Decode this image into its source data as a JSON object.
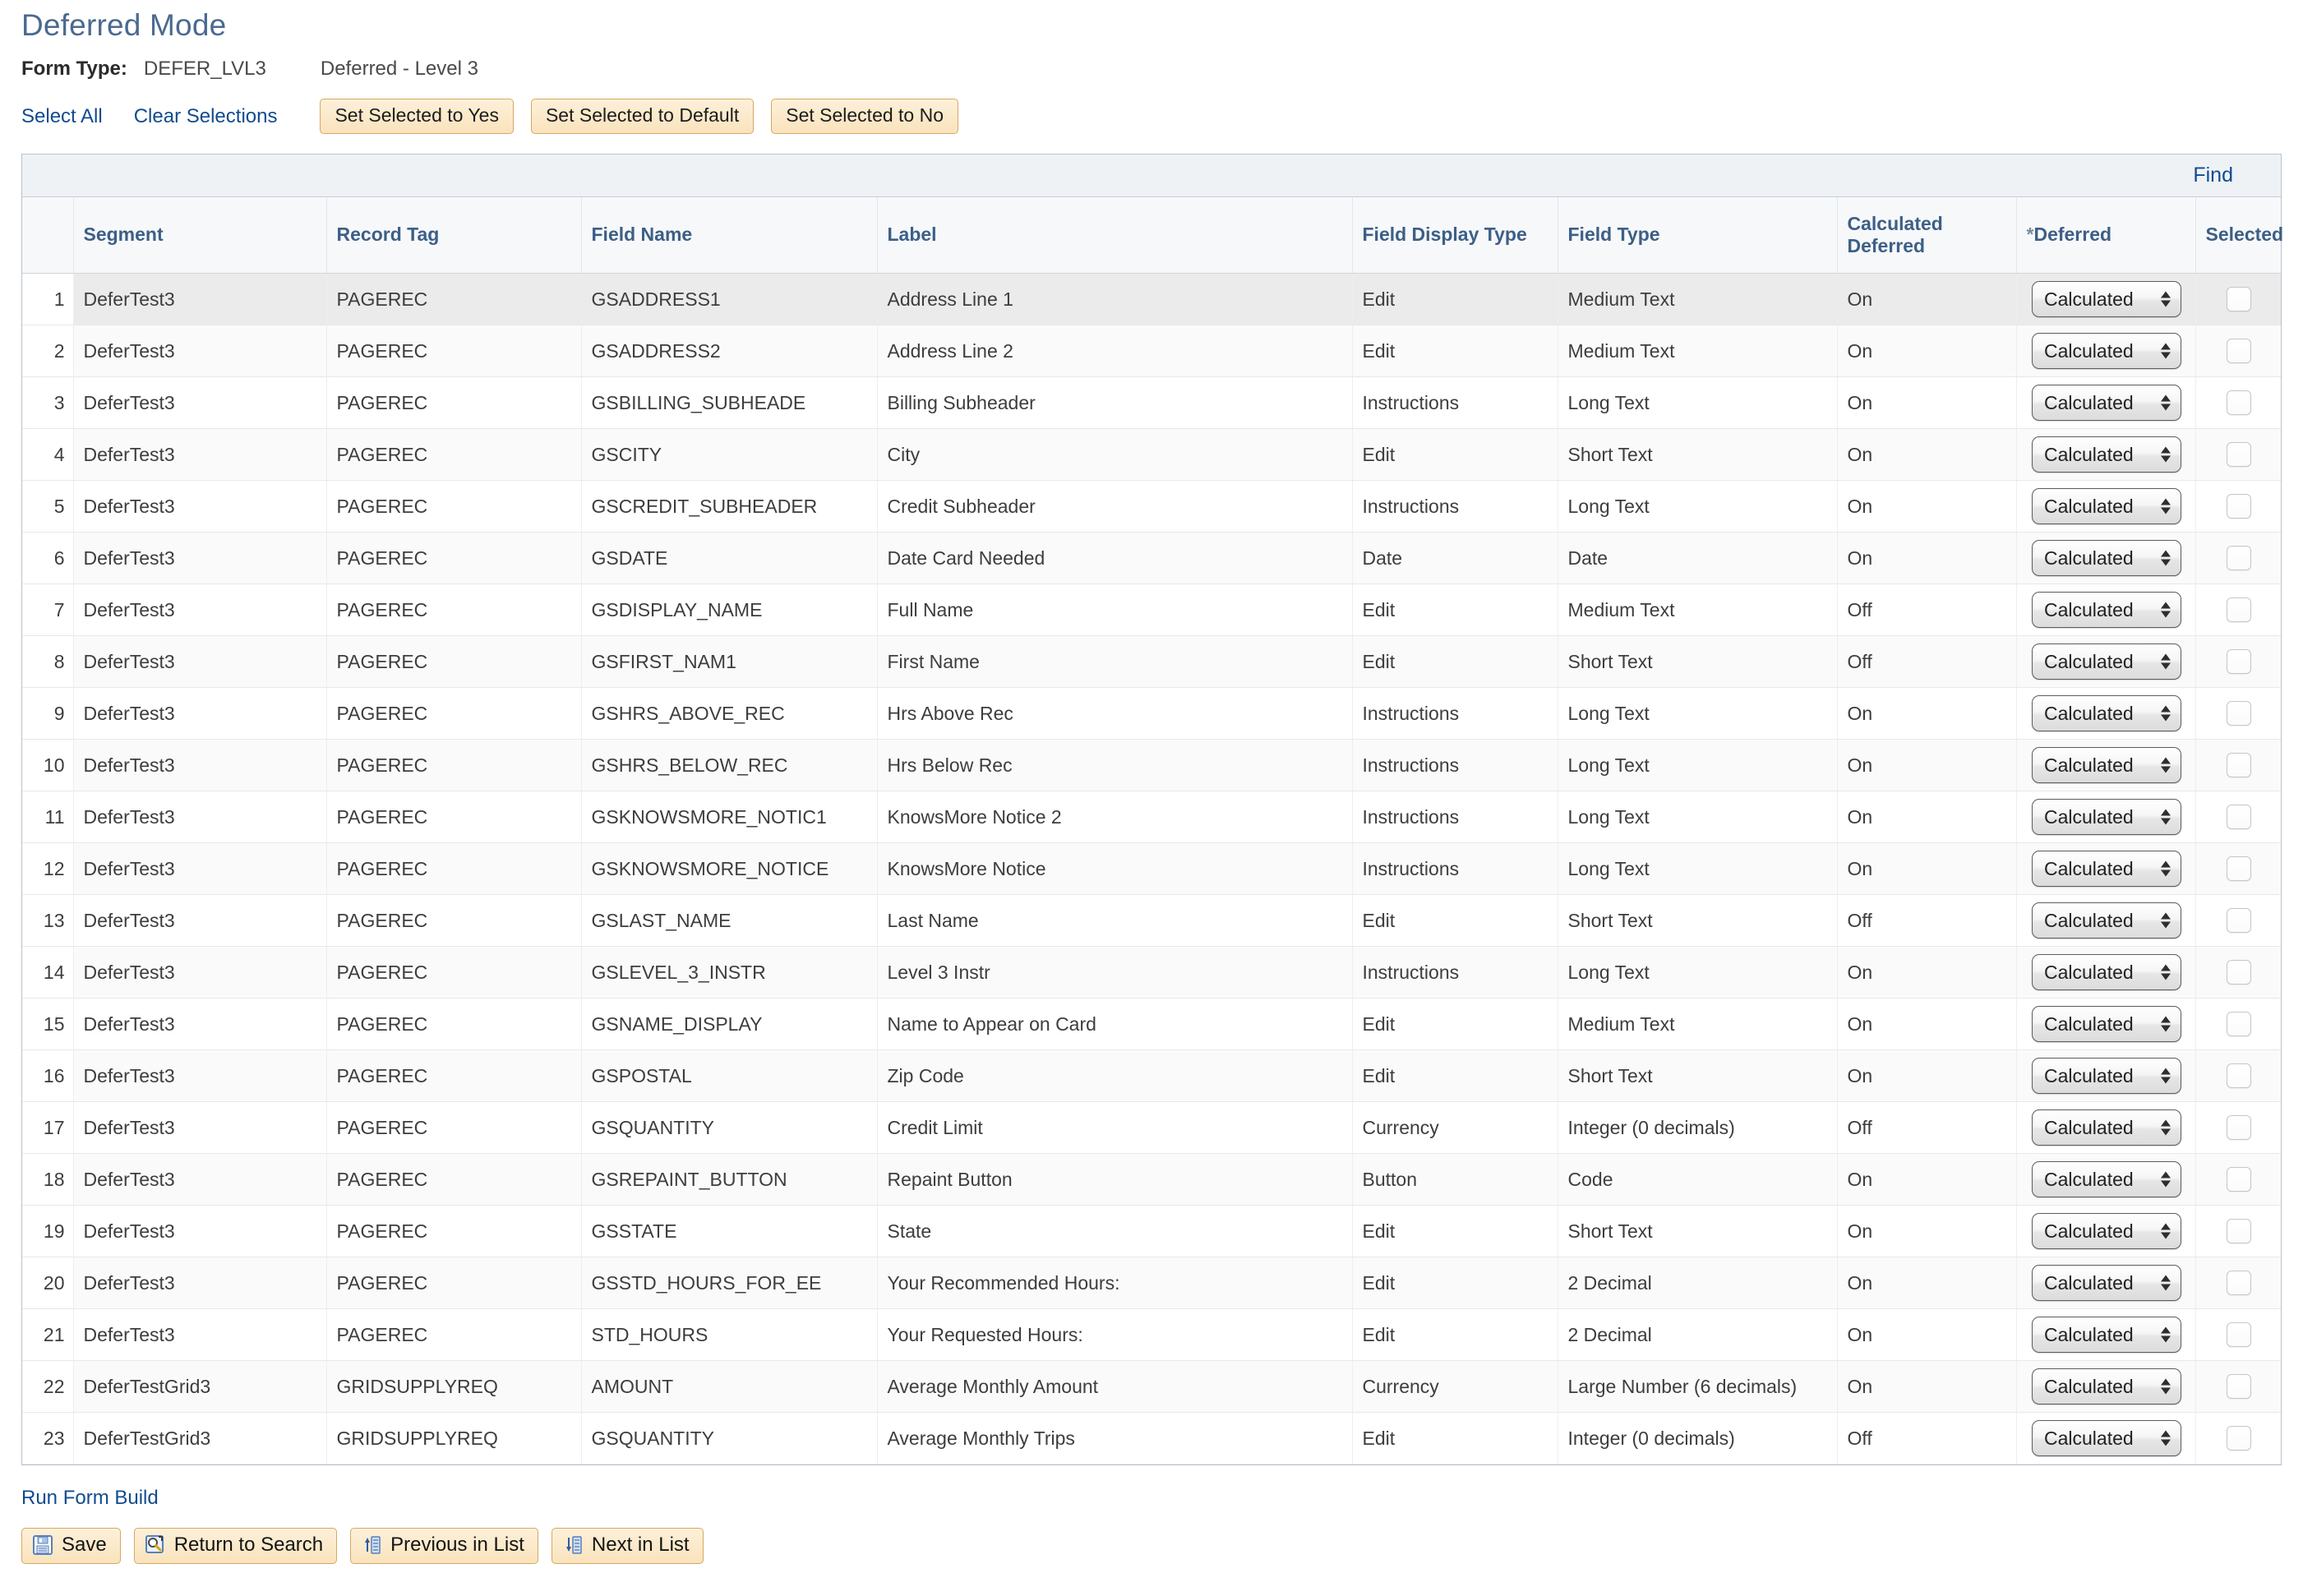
{
  "page": {
    "title": "Deferred Mode"
  },
  "form_type": {
    "label": "Form Type:",
    "value": "DEFER_LVL3",
    "description": "Deferred - Level 3"
  },
  "actions": {
    "select_all": "Select All",
    "clear_selections": "Clear Selections",
    "set_yes": "Set Selected to Yes",
    "set_default": "Set Selected to Default",
    "set_no": "Set Selected to No"
  },
  "grid": {
    "find_link": "Find",
    "columns": [
      "",
      "Segment",
      "Record Tag",
      "Field Name",
      "Label",
      "Field Display Type",
      "Field Type",
      "Calculated Deferred",
      "*Deferred",
      "Selected"
    ],
    "header": {
      "num": "",
      "segment": "Segment",
      "record_tag": "Record Tag",
      "field_name": "Field Name",
      "label": "Label",
      "field_display_type": "Field Display Type",
      "field_type": "Field Type",
      "calculated_deferred": "Calculated Deferred",
      "deferred_star": "*",
      "deferred": "Deferred",
      "selected": "Selected"
    },
    "deferred_value": "Calculated",
    "rows": [
      {
        "num": "1",
        "segment": "DeferTest3",
        "record_tag": "PAGEREC",
        "field_name": "GSADDRESS1",
        "label": "Address Line 1",
        "field_display_type": "Edit",
        "field_type": "Medium Text",
        "calculated_deferred": "On",
        "deferred": "Calculated",
        "selected": false
      },
      {
        "num": "2",
        "segment": "DeferTest3",
        "record_tag": "PAGEREC",
        "field_name": "GSADDRESS2",
        "label": "Address Line 2",
        "field_display_type": "Edit",
        "field_type": "Medium Text",
        "calculated_deferred": "On",
        "deferred": "Calculated",
        "selected": false
      },
      {
        "num": "3",
        "segment": "DeferTest3",
        "record_tag": "PAGEREC",
        "field_name": "GSBILLING_SUBHEADE",
        "label": "Billing Subheader",
        "field_display_type": "Instructions",
        "field_type": "Long Text",
        "calculated_deferred": "On",
        "deferred": "Calculated",
        "selected": false
      },
      {
        "num": "4",
        "segment": "DeferTest3",
        "record_tag": "PAGEREC",
        "field_name": "GSCITY",
        "label": "City",
        "field_display_type": "Edit",
        "field_type": "Short Text",
        "calculated_deferred": "On",
        "deferred": "Calculated",
        "selected": false
      },
      {
        "num": "5",
        "segment": "DeferTest3",
        "record_tag": "PAGEREC",
        "field_name": "GSCREDIT_SUBHEADER",
        "label": "Credit Subheader",
        "field_display_type": "Instructions",
        "field_type": "Long Text",
        "calculated_deferred": "On",
        "deferred": "Calculated",
        "selected": false
      },
      {
        "num": "6",
        "segment": "DeferTest3",
        "record_tag": "PAGEREC",
        "field_name": "GSDATE",
        "label": "Date Card Needed",
        "field_display_type": "Date",
        "field_type": "Date",
        "calculated_deferred": "On",
        "deferred": "Calculated",
        "selected": false
      },
      {
        "num": "7",
        "segment": "DeferTest3",
        "record_tag": "PAGEREC",
        "field_name": "GSDISPLAY_NAME",
        "label": "Full Name",
        "field_display_type": "Edit",
        "field_type": "Medium Text",
        "calculated_deferred": "Off",
        "deferred": "Calculated",
        "selected": false
      },
      {
        "num": "8",
        "segment": "DeferTest3",
        "record_tag": "PAGEREC",
        "field_name": "GSFIRST_NAM1",
        "label": "First Name",
        "field_display_type": "Edit",
        "field_type": "Short Text",
        "calculated_deferred": "Off",
        "deferred": "Calculated",
        "selected": false
      },
      {
        "num": "9",
        "segment": "DeferTest3",
        "record_tag": "PAGEREC",
        "field_name": "GSHRS_ABOVE_REC",
        "label": "Hrs Above Rec",
        "field_display_type": "Instructions",
        "field_type": "Long Text",
        "calculated_deferred": "On",
        "deferred": "Calculated",
        "selected": false
      },
      {
        "num": "10",
        "segment": "DeferTest3",
        "record_tag": "PAGEREC",
        "field_name": "GSHRS_BELOW_REC",
        "label": "Hrs Below Rec",
        "field_display_type": "Instructions",
        "field_type": "Long Text",
        "calculated_deferred": "On",
        "deferred": "Calculated",
        "selected": false
      },
      {
        "num": "11",
        "segment": "DeferTest3",
        "record_tag": "PAGEREC",
        "field_name": "GSKNOWSMORE_NOTIC1",
        "label": "KnowsMore Notice 2",
        "field_display_type": "Instructions",
        "field_type": "Long Text",
        "calculated_deferred": "On",
        "deferred": "Calculated",
        "selected": false
      },
      {
        "num": "12",
        "segment": "DeferTest3",
        "record_tag": "PAGEREC",
        "field_name": "GSKNOWSMORE_NOTICE",
        "label": "KnowsMore Notice",
        "field_display_type": "Instructions",
        "field_type": "Long Text",
        "calculated_deferred": "On",
        "deferred": "Calculated",
        "selected": false
      },
      {
        "num": "13",
        "segment": "DeferTest3",
        "record_tag": "PAGEREC",
        "field_name": "GSLAST_NAME",
        "label": "Last Name",
        "field_display_type": "Edit",
        "field_type": "Short Text",
        "calculated_deferred": "Off",
        "deferred": "Calculated",
        "selected": false
      },
      {
        "num": "14",
        "segment": "DeferTest3",
        "record_tag": "PAGEREC",
        "field_name": "GSLEVEL_3_INSTR",
        "label": "Level 3 Instr",
        "field_display_type": "Instructions",
        "field_type": "Long Text",
        "calculated_deferred": "On",
        "deferred": "Calculated",
        "selected": false
      },
      {
        "num": "15",
        "segment": "DeferTest3",
        "record_tag": "PAGEREC",
        "field_name": "GSNAME_DISPLAY",
        "label": "Name to Appear on Card",
        "field_display_type": "Edit",
        "field_type": "Medium Text",
        "calculated_deferred": "On",
        "deferred": "Calculated",
        "selected": false
      },
      {
        "num": "16",
        "segment": "DeferTest3",
        "record_tag": "PAGEREC",
        "field_name": "GSPOSTAL",
        "label": "Zip Code",
        "field_display_type": "Edit",
        "field_type": "Short Text",
        "calculated_deferred": "On",
        "deferred": "Calculated",
        "selected": false
      },
      {
        "num": "17",
        "segment": "DeferTest3",
        "record_tag": "PAGEREC",
        "field_name": "GSQUANTITY",
        "label": "Credit Limit",
        "field_display_type": "Currency",
        "field_type": "Integer (0 decimals)",
        "calculated_deferred": "Off",
        "deferred": "Calculated",
        "selected": false
      },
      {
        "num": "18",
        "segment": "DeferTest3",
        "record_tag": "PAGEREC",
        "field_name": "GSREPAINT_BUTTON",
        "label": "Repaint Button",
        "field_display_type": "Button",
        "field_type": "Code",
        "calculated_deferred": "On",
        "deferred": "Calculated",
        "selected": false
      },
      {
        "num": "19",
        "segment": "DeferTest3",
        "record_tag": "PAGEREC",
        "field_name": "GSSTATE",
        "label": "State",
        "field_display_type": "Edit",
        "field_type": "Short Text",
        "calculated_deferred": "On",
        "deferred": "Calculated",
        "selected": false
      },
      {
        "num": "20",
        "segment": "DeferTest3",
        "record_tag": "PAGEREC",
        "field_name": "GSSTD_HOURS_FOR_EE",
        "label": "Your Recommended Hours:",
        "field_display_type": "Edit",
        "field_type": "2 Decimal",
        "calculated_deferred": "On",
        "deferred": "Calculated",
        "selected": false
      },
      {
        "num": "21",
        "segment": "DeferTest3",
        "record_tag": "PAGEREC",
        "field_name": "STD_HOURS",
        "label": "Your Requested Hours:",
        "field_display_type": "Edit",
        "field_type": "2 Decimal",
        "calculated_deferred": "On",
        "deferred": "Calculated",
        "selected": false
      },
      {
        "num": "22",
        "segment": "DeferTestGrid3",
        "record_tag": "GRIDSUPPLYREQ",
        "field_name": "AMOUNT",
        "label": "Average Monthly Amount",
        "field_display_type": "Currency",
        "field_type": "Large Number (6 decimals)",
        "calculated_deferred": "On",
        "deferred": "Calculated",
        "selected": false
      },
      {
        "num": "23",
        "segment": "DeferTestGrid3",
        "record_tag": "GRIDSUPPLYREQ",
        "field_name": "GSQUANTITY",
        "label": "Average Monthly Trips",
        "field_display_type": "Edit",
        "field_type": "Integer (0 decimals)",
        "calculated_deferred": "Off",
        "deferred": "Calculated",
        "selected": false
      }
    ]
  },
  "footer": {
    "run_form_build": "Run Form Build",
    "save": "Save",
    "return_to_search": "Return to Search",
    "previous_in_list": "Previous in List",
    "next_in_list": "Next in List"
  },
  "colors": {
    "title_blue": "#4a6a8f",
    "link_blue": "#114b8f",
    "header_text_blue": "#3c5f86",
    "button_face": "#fae3bd",
    "button_border": "#d7a860"
  }
}
